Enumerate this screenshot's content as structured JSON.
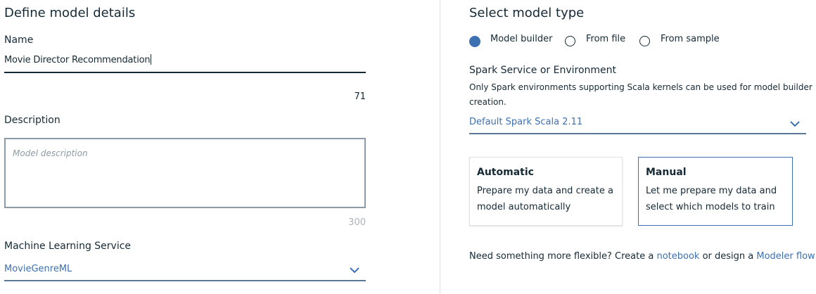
{
  "left": {
    "heading": "Define model details",
    "name": {
      "label": "Name",
      "value": "Movie Director Recommendation",
      "remaining": "71"
    },
    "description": {
      "label": "Description",
      "placeholder": "Model description",
      "remaining": "300"
    },
    "ml_service": {
      "label": "Machine Learning Service",
      "value": "MovieGenreML"
    }
  },
  "right": {
    "heading": "Select model type",
    "radios": [
      {
        "label": "Model builder",
        "selected": true
      },
      {
        "label": "From file",
        "selected": false
      },
      {
        "label": "From sample",
        "selected": false
      }
    ],
    "spark": {
      "label": "Spark Service or Environment",
      "helper_line1": "Only Spark environments supporting Scala kernels can be used for model builder",
      "helper_line2": "creation.",
      "value": "Default Spark Scala 2.11"
    },
    "cards": {
      "automatic": {
        "title": "Automatic",
        "description": "Prepare my data and create a model automatically"
      },
      "manual": {
        "title": "Manual",
        "description": "Let me prepare my data and select which models to train"
      }
    },
    "footer": {
      "prefix": "Need something more flexible? Create a ",
      "notebook_link": "notebook",
      "middle": " or design a ",
      "modeler_link": "Modeler flow"
    }
  },
  "colors": {
    "accent": "#3d70b2",
    "text": "#152935",
    "muted": "#8c9ba5"
  }
}
